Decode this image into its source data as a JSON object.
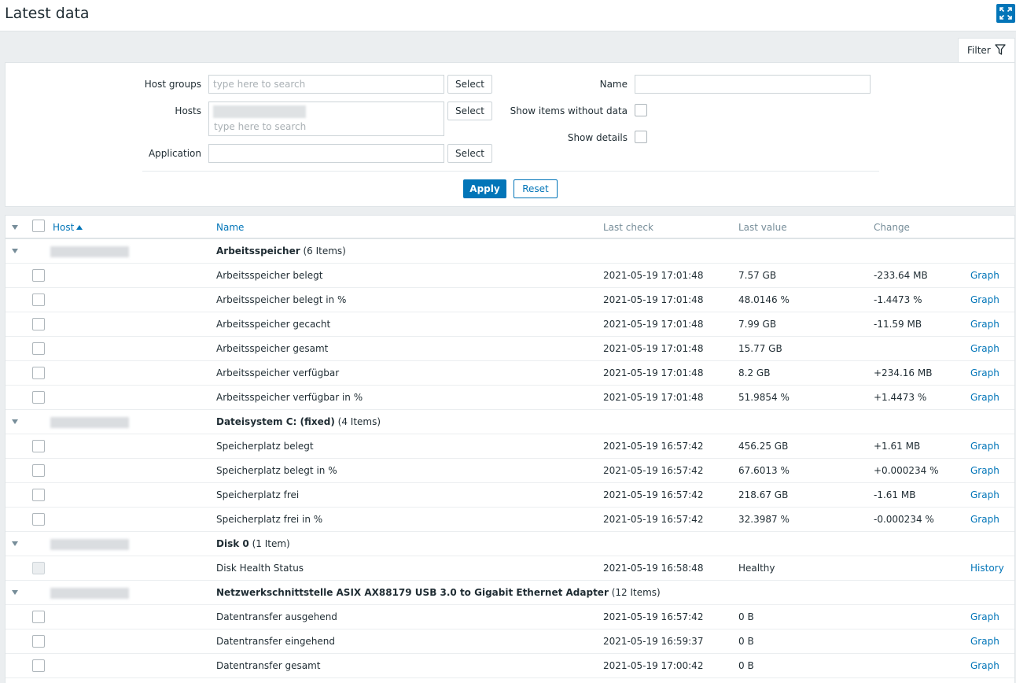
{
  "header": {
    "title": "Latest data"
  },
  "filter": {
    "tab_label": "Filter",
    "host_groups_label": "Host groups",
    "host_groups_placeholder": "type here to search",
    "hosts_label": "Hosts",
    "hosts_placeholder": "type here to search",
    "application_label": "Application",
    "application_value": "",
    "select_label": "Select",
    "name_label": "Name",
    "name_value": "",
    "show_items_without_data_label": "Show items without data",
    "show_details_label": "Show details",
    "apply_label": "Apply",
    "reset_label": "Reset"
  },
  "table": {
    "columns": {
      "host": "Host",
      "name": "Name",
      "last_check": "Last check",
      "last_value": "Last value",
      "change": "Change"
    },
    "groups": [
      {
        "name": "Arbeitsspeicher",
        "count": "(6 Items)",
        "items": [
          {
            "name": "Arbeitsspeicher belegt",
            "last_check": "2021-05-19 17:01:48",
            "last_value": "7.57 GB",
            "change": "-233.64 MB",
            "link": "Graph"
          },
          {
            "name": "Arbeitsspeicher belegt in %",
            "last_check": "2021-05-19 17:01:48",
            "last_value": "48.0146 %",
            "change": "-1.4473 %",
            "link": "Graph"
          },
          {
            "name": "Arbeitsspeicher gecacht",
            "last_check": "2021-05-19 17:01:48",
            "last_value": "7.99 GB",
            "change": "-11.59 MB",
            "link": "Graph"
          },
          {
            "name": "Arbeitsspeicher gesamt",
            "last_check": "2021-05-19 17:01:48",
            "last_value": "15.77 GB",
            "change": "",
            "link": "Graph"
          },
          {
            "name": "Arbeitsspeicher verfügbar",
            "last_check": "2021-05-19 17:01:48",
            "last_value": "8.2 GB",
            "change": "+234.16 MB",
            "link": "Graph"
          },
          {
            "name": "Arbeitsspeicher verfügbar in %",
            "last_check": "2021-05-19 17:01:48",
            "last_value": "51.9854 %",
            "change": "+1.4473 %",
            "link": "Graph"
          }
        ]
      },
      {
        "name": "Dateisystem C: (fixed)",
        "count": "(4 Items)",
        "items": [
          {
            "name": "Speicherplatz belegt",
            "last_check": "2021-05-19 16:57:42",
            "last_value": "456.25 GB",
            "change": "+1.61 MB",
            "link": "Graph"
          },
          {
            "name": "Speicherplatz belegt in %",
            "last_check": "2021-05-19 16:57:42",
            "last_value": "67.6013 %",
            "change": "+0.000234 %",
            "link": "Graph"
          },
          {
            "name": "Speicherplatz frei",
            "last_check": "2021-05-19 16:57:42",
            "last_value": "218.67 GB",
            "change": "-1.61 MB",
            "link": "Graph"
          },
          {
            "name": "Speicherplatz frei in %",
            "last_check": "2021-05-19 16:57:42",
            "last_value": "32.3987 %",
            "change": "-0.000234 %",
            "link": "Graph"
          }
        ]
      },
      {
        "name": "Disk 0",
        "count": "(1 Item)",
        "items": [
          {
            "name": "Disk Health Status",
            "last_check": "2021-05-19 16:58:48",
            "last_value": "Healthy",
            "change": "",
            "link": "History",
            "disabled": true
          }
        ]
      },
      {
        "name": "Netzwerkschnittstelle ASIX AX88179 USB 3.0 to Gigabit Ethernet Adapter",
        "count": "(12 Items)",
        "items": [
          {
            "name": "Datentransfer ausgehend",
            "last_check": "2021-05-19 16:57:42",
            "last_value": "0 B",
            "change": "",
            "link": "Graph"
          },
          {
            "name": "Datentransfer eingehend",
            "last_check": "2021-05-19 16:59:37",
            "last_value": "0 B",
            "change": "",
            "link": "Graph"
          },
          {
            "name": "Datentransfer gesamt",
            "last_check": "2021-05-19 17:00:42",
            "last_value": "0 B",
            "change": "",
            "link": "Graph"
          }
        ]
      }
    ]
  }
}
